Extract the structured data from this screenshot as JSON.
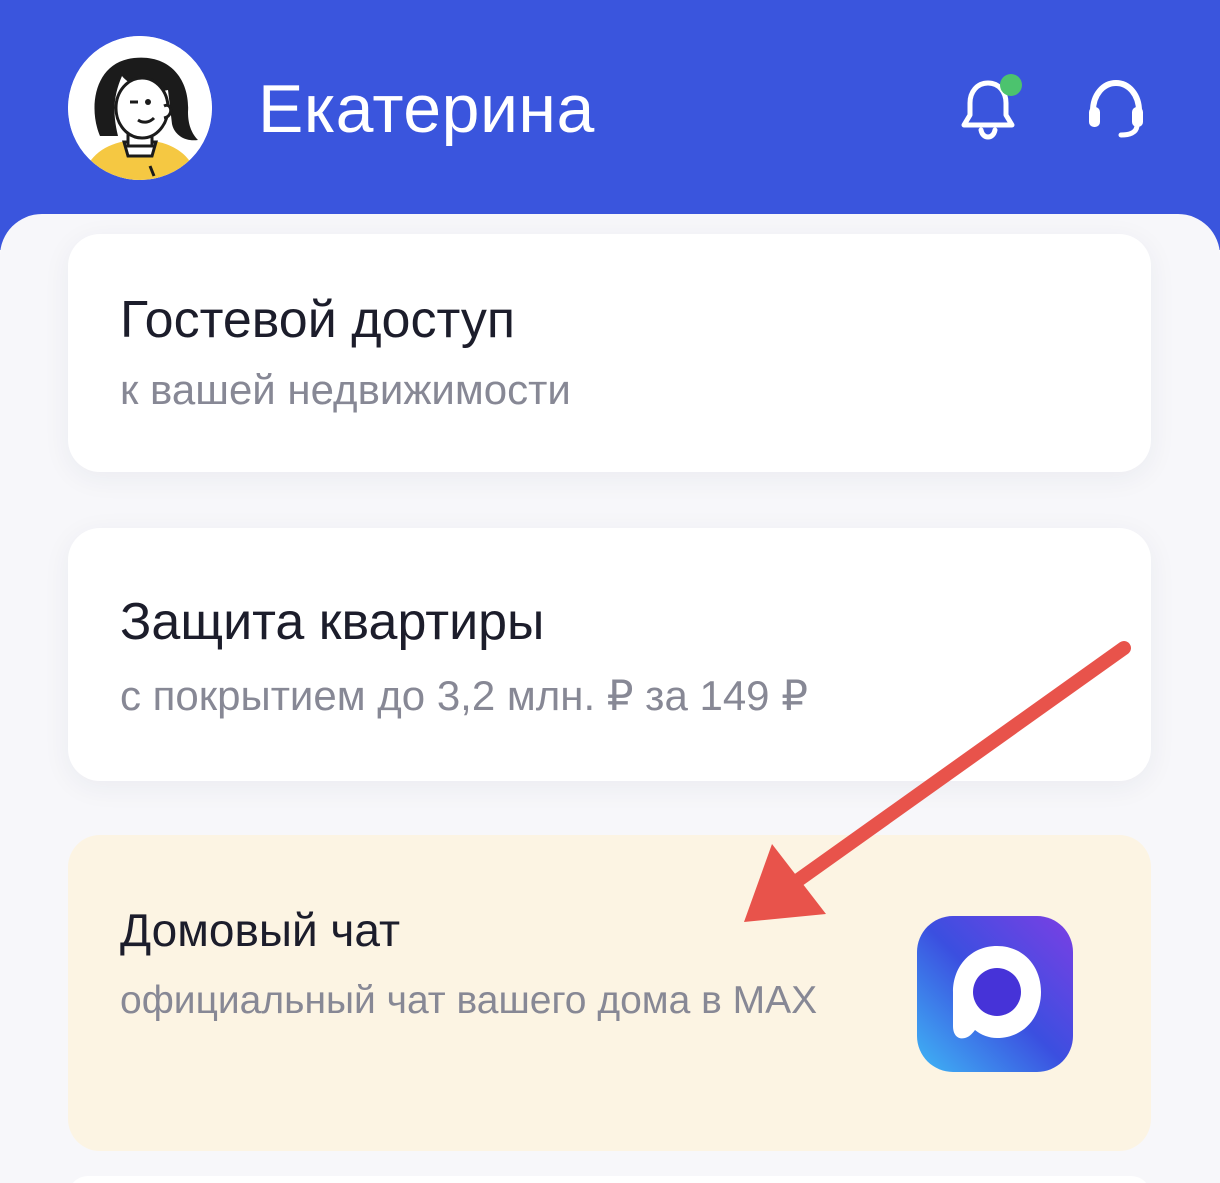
{
  "header": {
    "user_name": "Екатерина",
    "background_color": "#3a55dd",
    "avatar_icon": "user-avatar-illustration",
    "notifications_icon": "bell-icon",
    "notifications_has_new": true,
    "support_icon": "headset-icon"
  },
  "cards": [
    {
      "title": "Гостевой доступ",
      "subtitle": "к вашей недвижимости"
    },
    {
      "title": "Защита квартиры",
      "subtitle": "с покрытием до 3,2 млн. ₽ за 149 ₽"
    },
    {
      "title": "Домовый чат",
      "subtitle": "официальный чат вашего дома в MAX",
      "icon": "max-messenger-logo",
      "background_color": "#fcf4e3"
    }
  ],
  "annotation": {
    "icon": "red-arrow-pointer",
    "color": "#e8534b"
  }
}
